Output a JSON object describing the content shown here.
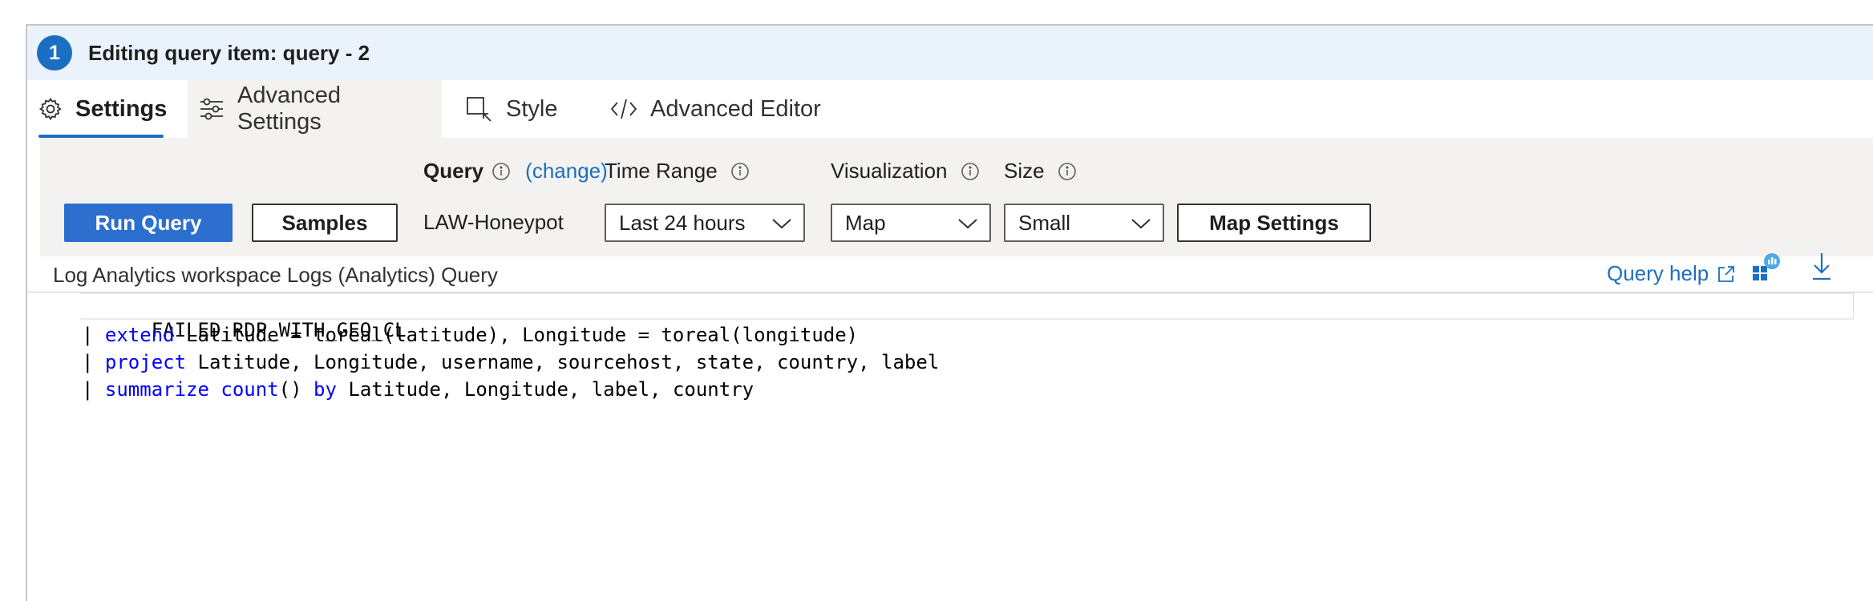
{
  "header": {
    "step": "1",
    "title": "Editing query item: query - 2"
  },
  "tabs": [
    {
      "label": "Settings",
      "icon": "gear-icon",
      "active": true
    },
    {
      "label": "Advanced Settings",
      "icon": "sliders-icon",
      "active": false
    },
    {
      "label": "Style",
      "icon": "style-icon",
      "active": false
    },
    {
      "label": "Advanced Editor",
      "icon": "code-icon",
      "active": false
    }
  ],
  "toolbar": {
    "run_query": "Run Query",
    "samples": "Samples",
    "query_label": "Query",
    "change_link": "(change)",
    "query_value": "LAW-Honeypot",
    "time_range_label": "Time Range",
    "time_range_value": "Last 24 hours",
    "visualization_label": "Visualization",
    "visualization_value": "Map",
    "size_label": "Size",
    "size_value": "Small",
    "map_settings": "Map Settings"
  },
  "query_section": {
    "title": "Log Analytics workspace Logs (Analytics) Query",
    "help_link": "Query help"
  },
  "code": {
    "line1": "FAILED_RDP_WITH_GEO_CL",
    "line2_pipe": "| ",
    "line2_kw": "extend",
    "line2_rest": " Latitude = toreal(latitude), Longitude = toreal(longitude)",
    "line3_pipe": "| ",
    "line3_kw": "project",
    "line3_rest": " Latitude, Longitude, username, sourcehost, state, country, label",
    "line4_pipe": "| ",
    "line4_kw1": "summarize",
    "line4_sp": " ",
    "line4_kw2": "count",
    "line4_mid": "() ",
    "line4_kw3": "by",
    "line4_rest": " Latitude, Longitude, label, country"
  },
  "colors": {
    "accent": "#1b6fc2",
    "header_bg": "#eaf3fc",
    "panel_bg": "#f3f2f1",
    "keyword": "#0000ff"
  }
}
